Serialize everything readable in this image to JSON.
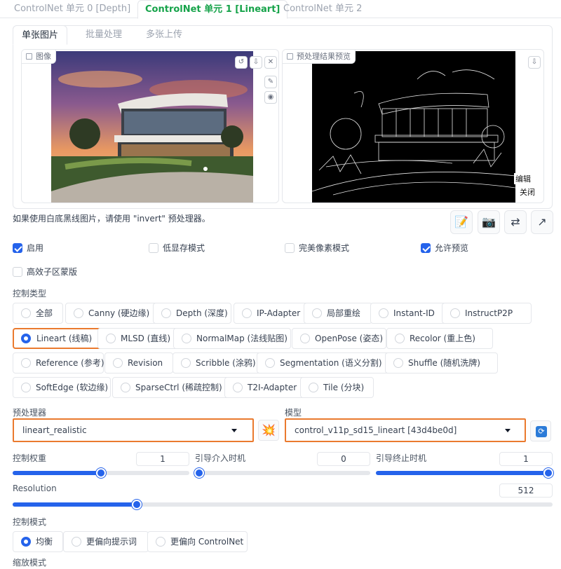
{
  "unit_tabs": [
    {
      "label": "ControlNet 单元 0 [Depth]",
      "active": false
    },
    {
      "label": "ControlNet 单元 1 [Lineart]",
      "active": true
    },
    {
      "label": "ControlNet 单元 2",
      "active": false
    }
  ],
  "sub_tabs": [
    "单张图片",
    "批量处理",
    "多张上传"
  ],
  "image_panel": {
    "label": "图像"
  },
  "preview_panel": {
    "label": "预处理结果预览",
    "edit_label": "编辑",
    "close_label": "关闭"
  },
  "hint": "如果使用白底黑线图片，请使用 \"invert\" 预处理器。",
  "checkboxes": {
    "enable": {
      "label": "启用",
      "checked": true
    },
    "low_vram": {
      "label": "低显存模式",
      "checked": false
    },
    "pixel_perfect": {
      "label": "完美像素模式",
      "checked": false
    },
    "allow_preview": {
      "label": "允许预览",
      "checked": true
    },
    "efficient_mask": {
      "label": "高效子区蒙版",
      "checked": false
    }
  },
  "control_type": {
    "label": "控制类型",
    "options": [
      "全部",
      "Canny (硬边缘)",
      "Depth (深度)",
      "IP-Adapter",
      "局部重绘",
      "Instant-ID",
      "InstructP2P",
      "Lineart (线稿)",
      "MLSD (直线)",
      "NormalMap (法线贴图)",
      "OpenPose (姿态)",
      "Recolor (重上色)",
      "Reference (参考)",
      "Revision",
      "Scribble (涂鸦)",
      "Segmentation (语义分割)",
      "Shuffle (随机洗牌)",
      "SoftEdge (软边缘)",
      "SparseCtrl (稀疏控制)",
      "T2I-Adapter",
      "Tile (分块)"
    ],
    "selected": "Lineart (线稿)"
  },
  "preprocessor": {
    "label": "预处理器",
    "value": "lineart_realistic"
  },
  "model": {
    "label": "模型",
    "value": "control_v11p_sd15_lineart [43d4be0d]"
  },
  "sliders": {
    "weight": {
      "label": "控制权重",
      "value": "1",
      "fraction": 0.5
    },
    "start": {
      "label": "引导介入时机",
      "value": "0",
      "fraction": 0.0
    },
    "end": {
      "label": "引导终止时机",
      "value": "1",
      "fraction": 1.0
    },
    "resolution": {
      "label": "Resolution",
      "value": "512",
      "fraction": 0.23
    }
  },
  "control_mode": {
    "label": "控制模式",
    "options": [
      "均衡",
      "更偏向提示词",
      "更偏向 ControlNet"
    ],
    "selected": "均衡"
  },
  "resize_mode": {
    "label": "缩放模式"
  },
  "colors": {
    "accent": "#2563eb",
    "highlight": "#ea7a2e",
    "active_tab": "#16a34a"
  }
}
